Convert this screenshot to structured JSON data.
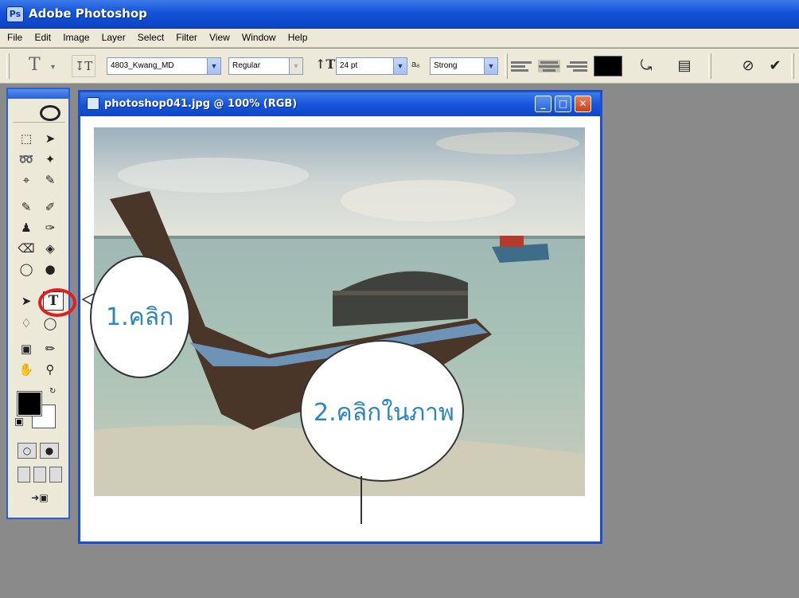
{
  "app": {
    "title": "Adobe Photoshop",
    "icon": "photoshop-eye-icon"
  },
  "menu": [
    "File",
    "Edit",
    "Image",
    "Layer",
    "Select",
    "Filter",
    "View",
    "Window",
    "Help"
  ],
  "options": {
    "tool_glyph": "T",
    "font_family": "4803_Kwang_MD",
    "font_style": "Regular",
    "font_size": "24 pt",
    "antialias_label": "aₐ",
    "antialias": "Strong",
    "color": "#000000"
  },
  "document": {
    "title": "photoshop041.jpg @ 100% (RGB)",
    "controls": {
      "minimize": "_",
      "maximize": "□",
      "close": "✕"
    }
  },
  "annotations": {
    "step1": "1.คลิก",
    "step2": "2.คลิกในภาพ"
  },
  "toolbox": {
    "active_tool": "T",
    "foreground": "#000000",
    "background": "#ffffff",
    "highlight_color": "#e02020"
  }
}
